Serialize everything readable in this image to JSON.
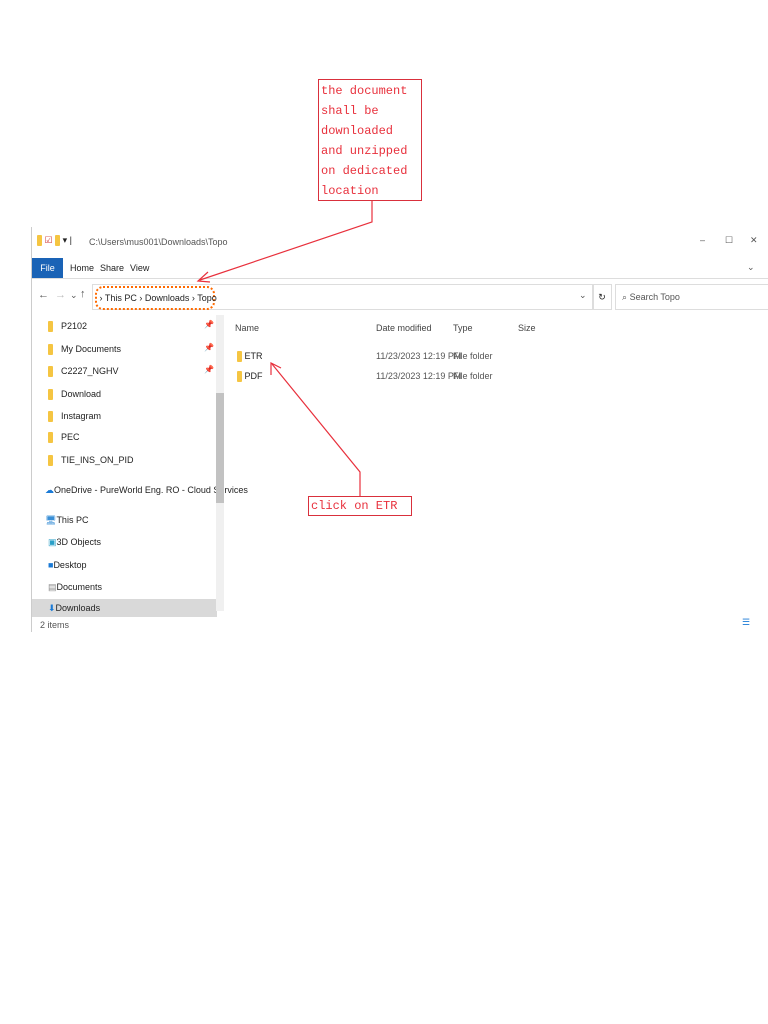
{
  "annotations": {
    "top_note": "the document shall be downloaded and unzipped on dedicated location",
    "bottom_note": "click on ETR"
  },
  "window": {
    "title": "C:\\Users\\mus001\\Downloads\\Topo",
    "controls": [
      "–",
      "☐",
      "✕"
    ]
  },
  "ribbon": {
    "tabs": [
      "File",
      "Home",
      "Share",
      "View"
    ]
  },
  "address": {
    "crumbs": [
      "This PC",
      "Downloads",
      "Topo"
    ],
    "search_placeholder": "Search Topo"
  },
  "sidebar": {
    "items": [
      {
        "label": "P2102",
        "icon": "folder-icon",
        "pinned": true
      },
      {
        "label": "My Documents",
        "icon": "folder-icon",
        "pinned": true
      },
      {
        "label": "C2227_NGHV",
        "icon": "folder-icon",
        "pinned": true
      },
      {
        "label": "Download",
        "icon": "folder-icon"
      },
      {
        "label": "Instagram",
        "icon": "folder-icon"
      },
      {
        "label": "PEC",
        "icon": "folder-icon"
      },
      {
        "label": "TIE_INS_ON_PID",
        "icon": "folder-icon"
      },
      {
        "label": "OneDrive - PureWorld Eng. RO - Cloud Services",
        "icon": "cloud-icon"
      },
      {
        "label": "This PC",
        "icon": "pc-icon"
      },
      {
        "label": "3D Objects",
        "icon": "cube-icon"
      },
      {
        "label": "Desktop",
        "icon": "desktop-icon"
      },
      {
        "label": "Documents",
        "icon": "document-icon"
      },
      {
        "label": "Downloads",
        "icon": "download-icon"
      }
    ]
  },
  "columns": [
    "Name",
    "Date modified",
    "Type",
    "Size"
  ],
  "files": [
    {
      "name": "ETR",
      "date": "11/23/2023 12:19 PM",
      "type": "File folder"
    },
    {
      "name": "PDF",
      "date": "11/23/2023 12:19 PM",
      "type": "File folder"
    }
  ],
  "status": "2 items",
  "colors": {
    "accent": "#1a63b6",
    "annotation": "#e8303c",
    "highlight": "#ff6a00"
  }
}
